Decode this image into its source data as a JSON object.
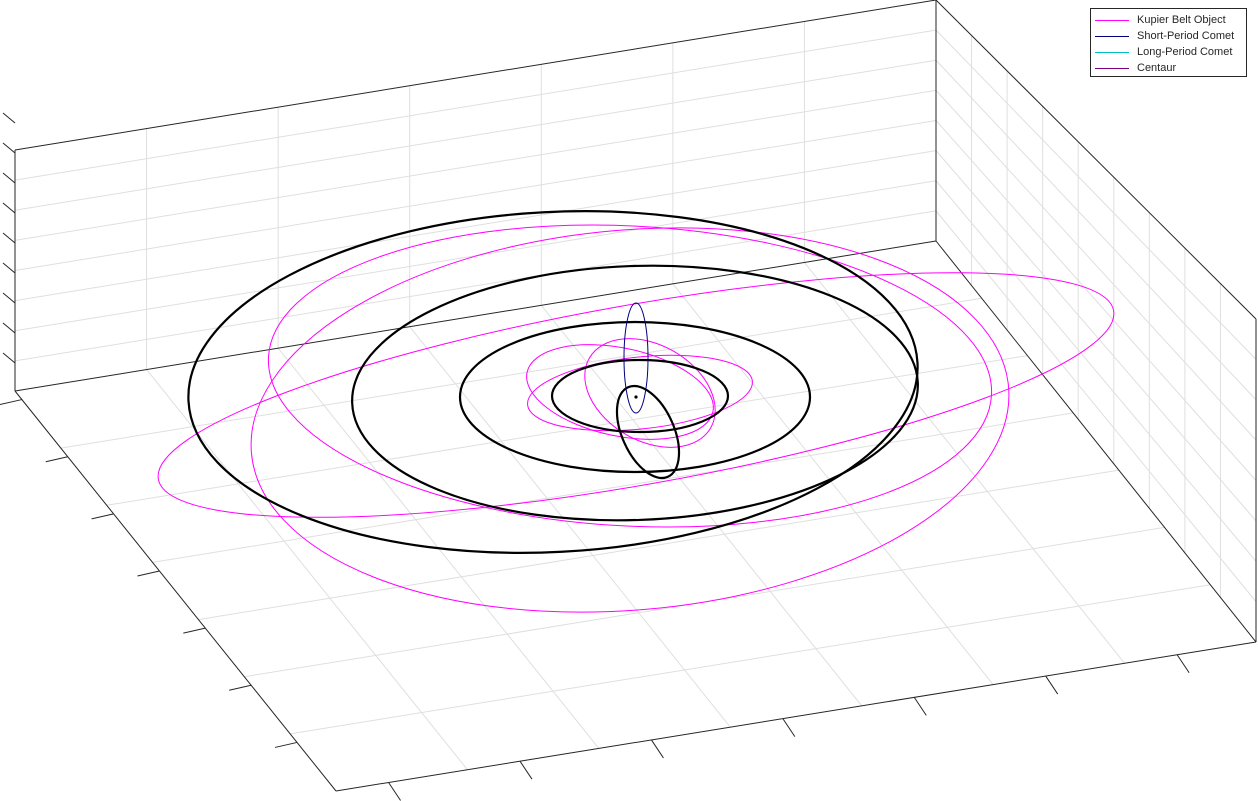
{
  "chart_data": {
    "type": "line",
    "projection": "3d",
    "title": "",
    "xlabel": "",
    "ylabel": "",
    "zlabel": "",
    "grid": true,
    "legend_location": "top-right",
    "legend": [
      {
        "label": "Kupier Belt Object",
        "color": "#ff00ff"
      },
      {
        "label": "Short-Period Comet",
        "color": "#00007f"
      },
      {
        "label": "Long-Period Comet",
        "color": "#00bfbf"
      },
      {
        "label": "Centaur",
        "color": "#7f007f"
      }
    ],
    "series": [
      {
        "name": "Kupier Belt Object",
        "color": "#ff00ff",
        "orbit_count": 3
      },
      {
        "name": "Short-Period Comet",
        "color": "#00007f",
        "orbit_count": 1
      },
      {
        "name": "Long-Period Comet",
        "color": "#00bfbf",
        "orbit_count": 0
      },
      {
        "name": "Centaur",
        "color": "#7f007f",
        "orbit_count": 3
      },
      {
        "color": "#000000",
        "orbit_count": 6
      }
    ],
    "sun_marker": true
  }
}
